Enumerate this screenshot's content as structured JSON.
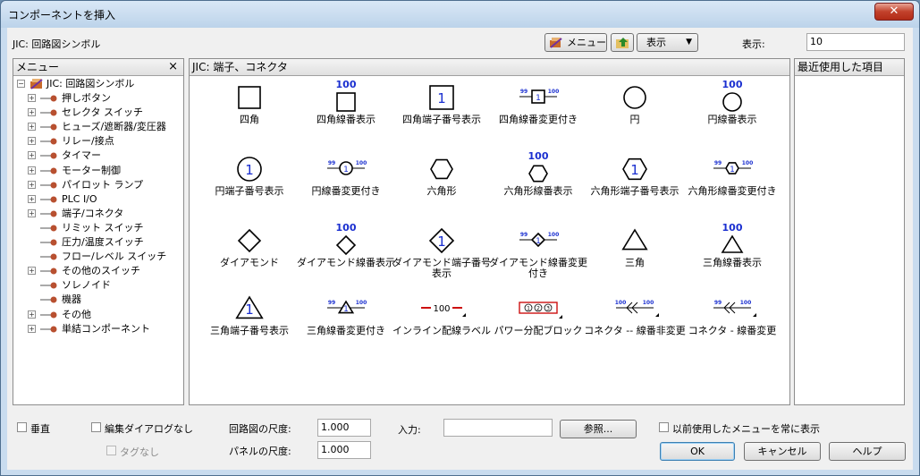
{
  "window": {
    "title": "コンポーネントを挿入",
    "close_glyph": "✕"
  },
  "toolbar": {
    "library_label": "JIC: 回路図シンボル",
    "menu_button": "メニュー",
    "view_button": "表示",
    "view_arrow": "▼",
    "display_label": "表示:",
    "display_value": "10"
  },
  "menu_panel": {
    "title": "メニュー",
    "close_glyph": "×",
    "root": "JIC: 回路図シンボル",
    "items": [
      {
        "label": "押しボタン",
        "expandable": true
      },
      {
        "label": "セレクタ スイッチ",
        "expandable": true
      },
      {
        "label": "ヒューズ/遮断器/変圧器",
        "expandable": true
      },
      {
        "label": "リレー/接点",
        "expandable": true
      },
      {
        "label": "タイマー",
        "expandable": true
      },
      {
        "label": "モーター制御",
        "expandable": true
      },
      {
        "label": "パイロット ランプ",
        "expandable": true
      },
      {
        "label": "PLC I/O",
        "expandable": true
      },
      {
        "label": "端子/コネクタ",
        "expandable": true
      },
      {
        "label": "リミット スイッチ",
        "expandable": false
      },
      {
        "label": "圧力/温度スイッチ",
        "expandable": false
      },
      {
        "label": "フロー/レベル スイッチ",
        "expandable": false
      },
      {
        "label": "その他のスイッチ",
        "expandable": true
      },
      {
        "label": "ソレノイド",
        "expandable": false
      },
      {
        "label": "機器",
        "expandable": false
      },
      {
        "label": "その他",
        "expandable": true
      },
      {
        "label": "単結コンポーネント",
        "expandable": true
      }
    ]
  },
  "symbols_panel": {
    "title": "JIC: 端子、コネクタ",
    "rows": [
      [
        {
          "icon": "square",
          "label": "四角"
        },
        {
          "icon": "square-wire",
          "label": "四角線番表示",
          "num": "100"
        },
        {
          "icon": "square-terminal",
          "label": "四角端子番号表示",
          "num": "1"
        },
        {
          "icon": "square-change",
          "label": "四角線番変更付き",
          "num": "1",
          "left": "99",
          "right": "100"
        },
        {
          "icon": "circle",
          "label": "円"
        },
        {
          "icon": "circle-wire",
          "label": "円線番表示",
          "num": "100"
        }
      ],
      [
        {
          "icon": "circle-terminal",
          "label": "円端子番号表示",
          "num": "1"
        },
        {
          "icon": "circle-change",
          "label": "円線番変更付き",
          "num": "1",
          "left": "99",
          "right": "100"
        },
        {
          "icon": "hexagon",
          "label": "六角形"
        },
        {
          "icon": "hexagon-wire",
          "label": "六角形線番表示",
          "num": "100"
        },
        {
          "icon": "hexagon-terminal",
          "label": "六角形端子番号表示",
          "num": "1"
        },
        {
          "icon": "hexagon-change",
          "label": "六角形線番変更付き",
          "num": "1",
          "left": "99",
          "right": "100"
        }
      ],
      [
        {
          "icon": "diamond",
          "label": "ダイアモンド"
        },
        {
          "icon": "diamond-wire",
          "label": "ダイアモンド線番表示",
          "num": "100"
        },
        {
          "icon": "diamond-terminal",
          "label": "ダイアモンド端子番号表示",
          "num": "1"
        },
        {
          "icon": "diamond-change",
          "label": "ダイアモンド線番変更付き",
          "num": "1",
          "left": "99",
          "right": "100"
        },
        {
          "icon": "triangle",
          "label": "三角"
        },
        {
          "icon": "triangle-wire",
          "label": "三角線番表示",
          "num": "100"
        }
      ],
      [
        {
          "icon": "triangle-terminal",
          "label": "三角端子番号表示",
          "num": "1"
        },
        {
          "icon": "triangle-change",
          "label": "三角線番変更付き",
          "num": "1",
          "left": "99",
          "right": "100"
        },
        {
          "icon": "inline-wire",
          "label": "インライン配線ラベル",
          "num": "100"
        },
        {
          "icon": "power-block",
          "label": "パワー分配ブロック",
          "b1": "1",
          "b2": "2",
          "b3": "3"
        },
        {
          "icon": "connector-nochange",
          "label": "コネクタ -- 線番非変更",
          "left": "100",
          "right": "100"
        },
        {
          "icon": "connector-change",
          "label": "コネクタ - 線番変更",
          "left": "99",
          "right": "100"
        }
      ]
    ]
  },
  "recent_panel": {
    "title": "最近使用した項目"
  },
  "bottom": {
    "vertical_label": "垂直",
    "no_edit_dialog_label": "編集ダイアログなし",
    "no_tag_label": "タグなし",
    "schematic_scale_label": "回路図の尺度:",
    "schematic_scale_value": "1.000",
    "panel_scale_label": "パネルの尺度:",
    "panel_scale_value": "1.000",
    "input_label": "入力:",
    "input_value": "",
    "browse_button": "参照...",
    "always_show_label": "以前使用したメニューを常に表示",
    "ok_button": "OK",
    "cancel_button": "キャンセル",
    "help_button": "ヘルプ"
  },
  "colors": {
    "accent_blue": "#1a2fd0",
    "red": "#cc1010"
  }
}
